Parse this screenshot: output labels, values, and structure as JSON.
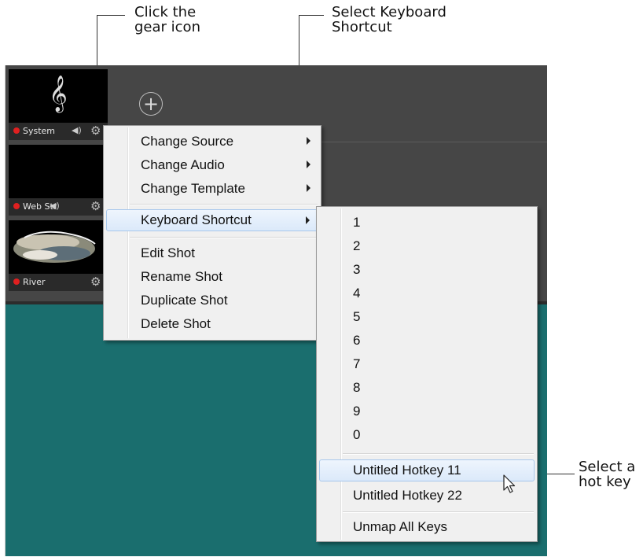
{
  "callouts": {
    "gear": "Click the\ngear icon",
    "shortcut": "Select Keyboard\nShortcut",
    "hotkey": "Select a\nhot key"
  },
  "shots": [
    {
      "label": "System",
      "thumbnail": "treble-clef-icon"
    },
    {
      "label": "Web Str",
      "thumbnail": "black"
    },
    {
      "label": "River",
      "thumbnail": "landscape-image"
    }
  ],
  "add_button": "+",
  "context_menu": {
    "items": [
      {
        "label": "Change Source",
        "submenu": true
      },
      {
        "label": "Change Audio",
        "submenu": true
      },
      {
        "label": "Change Template",
        "submenu": true
      },
      {
        "label": "Keyboard Shortcut",
        "submenu": true,
        "highlighted": true
      },
      {
        "label": "Edit Shot"
      },
      {
        "label": "Rename Shot"
      },
      {
        "label": "Duplicate Shot"
      },
      {
        "label": "Delete Shot"
      }
    ]
  },
  "submenu": {
    "keys": [
      "1",
      "2",
      "3",
      "4",
      "5",
      "6",
      "7",
      "8",
      "9",
      "0"
    ],
    "hotkeys": [
      "Untitled Hotkey 11",
      "Untitled Hotkey 22"
    ],
    "unmap": "Unmap All Keys"
  },
  "colors": {
    "stage": "#1a6e6e",
    "toolbar": "#464646",
    "live_dot": "#e02020",
    "highlight_border": "#a8c8ec"
  }
}
